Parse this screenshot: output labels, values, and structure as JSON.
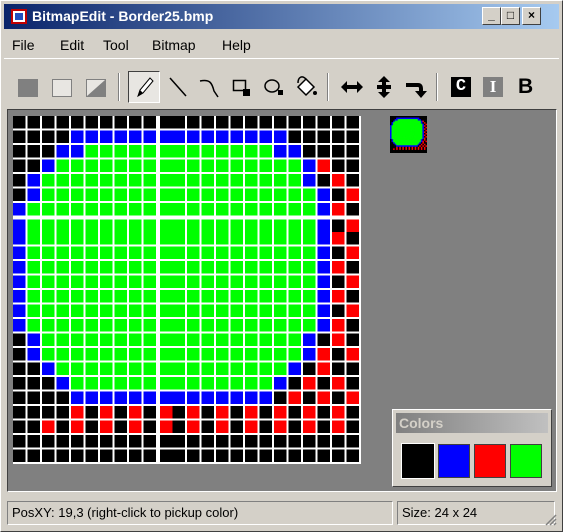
{
  "window": {
    "title": "BitmapEdit - Border25.bmp",
    "controls": {
      "minimize": "_",
      "maximize": "□",
      "close": "×"
    }
  },
  "menu": [
    "File",
    "Edit",
    "Tool",
    "Bitmap",
    "Help"
  ],
  "toolbar": {
    "tools": [
      {
        "icon": "fill-rect-icon"
      },
      {
        "icon": "empty-rect-icon"
      },
      {
        "icon": "gradient-rect-icon"
      },
      {
        "icon": "pencil-icon",
        "active": true
      },
      {
        "icon": "line-icon"
      },
      {
        "icon": "curve-icon"
      },
      {
        "icon": "rect-tool-icon"
      },
      {
        "icon": "ellipse-tool-icon"
      },
      {
        "icon": "paint-bucket-icon"
      },
      {
        "icon": "flip-horizontal-icon"
      },
      {
        "icon": "flip-vertical-icon"
      },
      {
        "icon": "rotate-icon"
      }
    ],
    "text_buttons": {
      "c": "C",
      "i": "I",
      "b": "B"
    }
  },
  "bitmap": {
    "width": 24,
    "height": 24,
    "palette": {
      "K": "#000000",
      "B": "#0000ff",
      "R": "#ff0000",
      "G": "#00ff00"
    },
    "rows": [
      "KKKKKKKKKKKKKKKKKKKKKKKK",
      "KKKKBBBBBBBBBBBBBBBKKKKK",
      "KKKBBGGGGGGGGGGGGGBBKKKK",
      "KKBGGGGGGGGGGGGGGGGGBRKK",
      "KBGGGGGGGGGGGGGGGGGGBKRK",
      "KBGGGGGGGGGGGGGGGGGGGBKR",
      "BGGGGGGGGGGGGGGGGGGGGBRK",
      "BGGGGGGGGGGGGGGGGGGGGBKR",
      "BGGGGGGGGGGGGGGGGGGGGBRK",
      "BGGGGGGGGGGGGGGGGGGGGBKR",
      "BGGGGGGGGGGGGGGGGGGGGBRK",
      "BGGGGGGGGGGGGGGGGGGGGBKR",
      "BGGGGGGGGGGGGGGGGGGGGBRK",
      "BGGGGGGGGGGGGGGGGGGGGBKR",
      "BGGGGGGGGGGGGGGGGGGGGBRK",
      "KBGGGGGGGGGGGGGGGGGGBKRK",
      "KBGGGGGGGGGGGGGGGGGGBRKR",
      "KKBGGGGGGGGGGGGGGGGBKRKK",
      "KKKBGGGGGGGGGGGGGGBKRKRK",
      "KKKKBBBBBBBBBBBBBBKRKRKR",
      "KKKKRKRKRKRKRKRKRKRKRKRK",
      "KKRKRKRKRKRKRKRKRKRKRKRK",
      "KKKKKKKKKKKKKKKKKKKKKKKK",
      "KKKKKKKKKKKKKKKKKKKKKKKK"
    ],
    "grid_color": "#ffffff"
  },
  "colors_panel": {
    "title": "Colors",
    "swatches": [
      "#000000",
      "#0000ff",
      "#ff0000",
      "#00ff00"
    ],
    "selected": 0
  },
  "status": {
    "pos": "PosXY: 19,3  (right-click to pickup color)",
    "size": "Size: 24 x 24"
  }
}
